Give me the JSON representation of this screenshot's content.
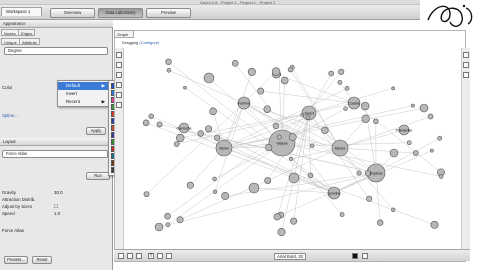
{
  "window": {
    "title": "Gephi 0.8 - Project 1 - Project 1 - Project 2"
  },
  "toolbar": {
    "workspace_tab": "Workspace 1",
    "overview": "Overview",
    "data_laboratory": "Data Laboratory",
    "preview": "Preview"
  },
  "appearance": {
    "panel_title": "Appearance",
    "tab_nodes": "Nodes",
    "tab_edges": "Edges",
    "tab_unique": "Unique",
    "tab_attribute": "Attribute",
    "attribute_value": "Degree",
    "color_label": "Color",
    "spline_label": "Spline...",
    "apply_label": "Apply"
  },
  "menu": {
    "items": [
      {
        "label": "Default",
        "arrow": "▶"
      },
      {
        "label": "Invert",
        "arrow": ""
      },
      {
        "label": "Recent",
        "arrow": "▶"
      }
    ]
  },
  "layout": {
    "panel_title": "Layout",
    "algorithm": "Force Atlas",
    "run_label": "Run",
    "props": [
      {
        "name": "Gravity",
        "value": "30.0"
      },
      {
        "name": "Attraction Distrib.",
        "value": ""
      },
      {
        "name": "Adjust by Sizes",
        "value": "☐"
      },
      {
        "name": "Speed",
        "value": "1.0"
      }
    ],
    "footer_label": "Force Atlas",
    "presets": "Presets...",
    "reset": "Reset"
  },
  "graph": {
    "tab": "Graph",
    "mode_label": "Dragging",
    "mode_value": "(Configure)",
    "font_label": "Arial Bold, 32"
  },
  "palette_colors": [
    [
      "#1f4fc7",
      "#6aa0e8",
      "#e9e9e9"
    ],
    [
      "#2d7fd6",
      "#e9e9e9",
      "#d9d9d9"
    ],
    [
      "#e03a8b",
      "#9a2fc3",
      "#c23da8"
    ],
    [
      "#3b9a3b",
      "#bfe06a",
      "#e8e84a"
    ],
    [
      "#d83a2e",
      "#f08a2e",
      "#f3c33a"
    ],
    [
      "#2f3fa8",
      "#5a7ee0",
      "#9fc0f2"
    ],
    [
      "#c94a2d",
      "#e2813b",
      "#f3c478"
    ],
    [
      "#3c3c8e",
      "#7a4aa8",
      "#c8a0d8"
    ],
    [
      "#2b8a2b",
      "#7cc35a",
      "#d2e8a0"
    ],
    [
      "#b93131",
      "#e26a6a",
      "#f4b2b2"
    ],
    [
      "#1e6e8e",
      "#4aa6c8",
      "#a6dcec"
    ],
    [
      "#6a3a1a",
      "#b0703a",
      "#e6c08a"
    ],
    [
      "#404040",
      "#8a8a8a",
      "#d0d0d0"
    ]
  ],
  "node_labels": [
    "Valjean",
    "Myriel",
    "Marius",
    "Enjolras",
    "Javert",
    "Fantine",
    "Cosette",
    "Gavroche",
    "Thenardier",
    "Eponine"
  ],
  "colors": {
    "menu_highlight": "#3d7bd8",
    "node_fill": "#b7b7b7",
    "node_stroke": "#555555"
  }
}
